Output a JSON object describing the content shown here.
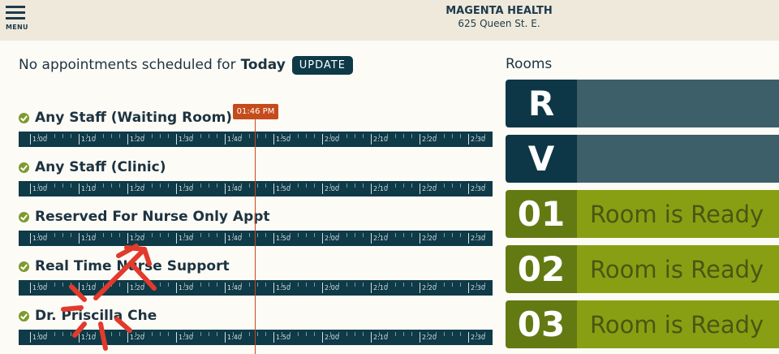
{
  "header": {
    "menu_label": "MENU",
    "clinic_name": "MAGENTA HEALTH",
    "clinic_address": "625 Queen St. E."
  },
  "schedule": {
    "status_text": "No appointments scheduled for",
    "day": "Today",
    "update_label": "UPDATE",
    "current_time": "01:46 PM",
    "time_labels": [
      "1:00",
      "1:10",
      "1:20",
      "1:30",
      "1:40",
      "1:50",
      "2:00",
      "2:10",
      "2:20",
      "2:30"
    ],
    "staff": [
      {
        "name": "Any Staff (Waiting Room)",
        "available": true
      },
      {
        "name": "Any Staff (Clinic)",
        "available": true
      },
      {
        "name": "Reserved For Nurse Only Appt",
        "available": true
      },
      {
        "name": "Real Time Nurse Support",
        "available": true
      },
      {
        "name": "Dr. Priscilla Che",
        "available": true
      }
    ]
  },
  "rooms": {
    "title": "Rooms",
    "items": [
      {
        "code": "R",
        "status": "",
        "state": "dark"
      },
      {
        "code": "V",
        "status": "",
        "state": "dark"
      },
      {
        "code": "01",
        "status": "Room is Ready",
        "state": "ready"
      },
      {
        "code": "02",
        "status": "Room is Ready",
        "state": "ready"
      },
      {
        "code": "03",
        "status": "Room is Ready",
        "state": "ready"
      }
    ]
  },
  "colors": {
    "header_bg": "#efe9db",
    "navy": "#0f3a47",
    "ready_green": "#899f13",
    "now_marker": "#c44b1c",
    "annotation_red": "#e23a2c"
  }
}
